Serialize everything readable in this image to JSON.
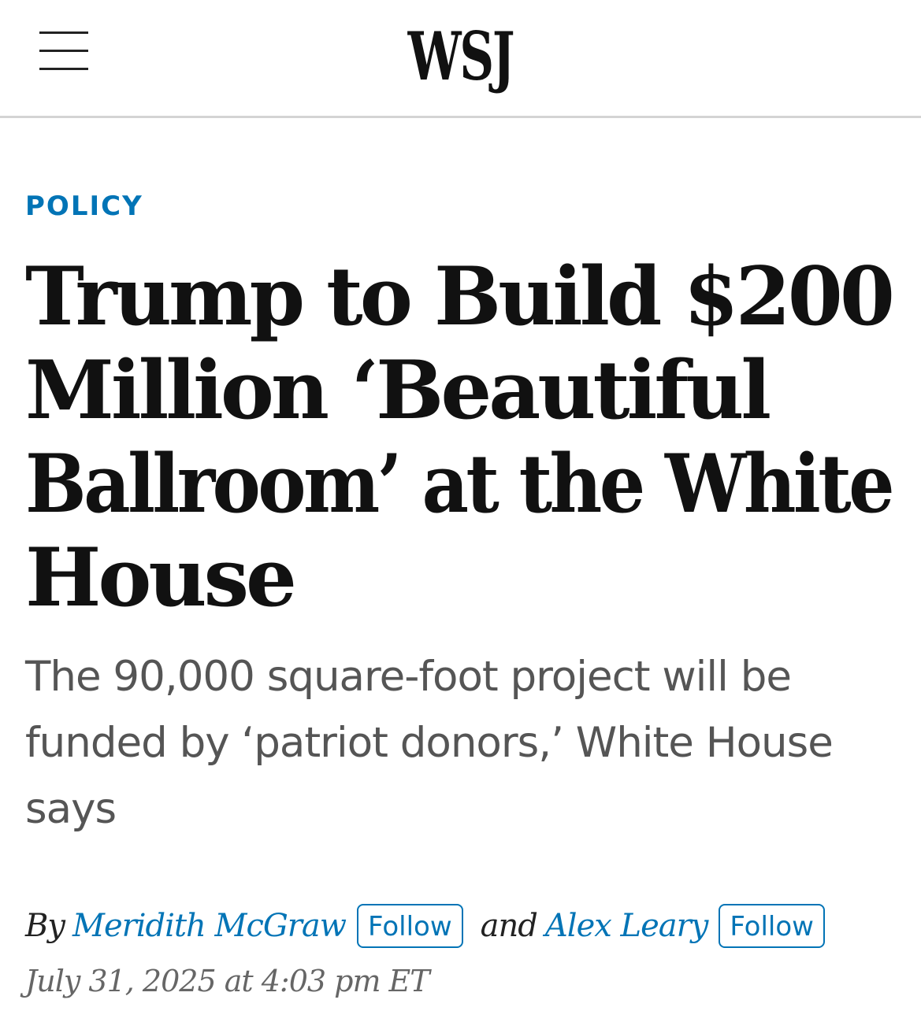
{
  "header": {
    "menu_icon": "hamburger-menu-icon",
    "logo_text": "WSJ"
  },
  "article": {
    "section": "POLICY",
    "headline_lines": [
      "Trump to Build $200",
      "Million ‘Beautiful",
      "Ballroom’ at the White",
      "House"
    ],
    "dek_lines": [
      "The 90,000 square-foot project will be",
      "funded by ‘patriot donors,’ White House",
      "says"
    ],
    "byline": {
      "prefix": "By",
      "author_1": "Meridith McGraw",
      "follow_label_1": "Follow",
      "conjunction": "and",
      "author_2": "Alex Leary",
      "follow_label_2": "Follow"
    },
    "date": "July 31, 2025 at 4:03 pm ET"
  },
  "colors": {
    "accent_blue": "#0274b6",
    "headline": "#111111",
    "dek": "#555555",
    "date": "#666666",
    "divider": "#d4d4d4"
  }
}
